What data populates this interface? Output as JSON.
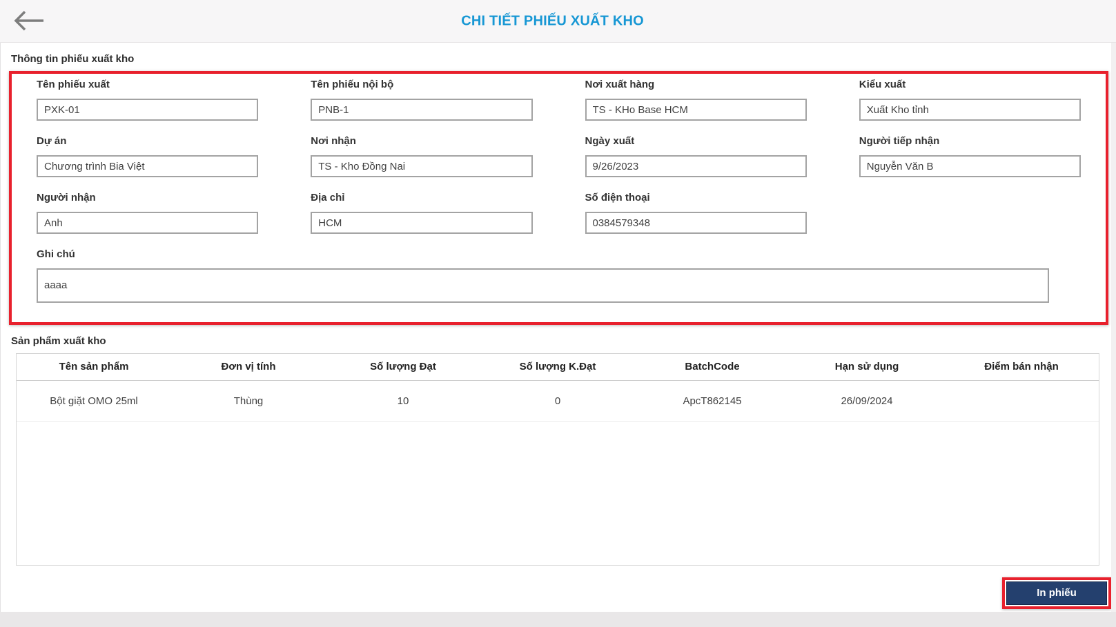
{
  "header": {
    "title": "CHI TIẾT PHIẾU XUẤT KHO"
  },
  "info_section": {
    "title": "Thông tin phiếu xuất kho",
    "fields": [
      {
        "label": "Tên phiếu xuất",
        "value": "PXK-01"
      },
      {
        "label": "Tên phiếu nội bộ",
        "value": "PNB-1"
      },
      {
        "label": "Nơi xuất hàng",
        "value": "TS - KHo Base HCM"
      },
      {
        "label": "Kiểu xuất",
        "value": "Xuất Kho tỉnh"
      },
      {
        "label": "Dự án",
        "value": "Chương trình Bia Việt"
      },
      {
        "label": "Nơi nhận",
        "value": "TS - Kho Đồng Nai"
      },
      {
        "label": "Ngày xuất",
        "value": "9/26/2023"
      },
      {
        "label": "Người tiếp nhận",
        "value": "Nguyễn Văn B"
      },
      {
        "label": "Người nhận",
        "value": "Anh"
      },
      {
        "label": "Địa chỉ",
        "value": "HCM"
      },
      {
        "label": "Số điện thoại",
        "value": "0384579348"
      },
      {
        "label": "Ghi chú",
        "value": "aaaa"
      }
    ]
  },
  "products_section": {
    "title": "Sản phẩm xuất kho",
    "table": {
      "columns": [
        "Tên sản phẩm",
        "Đơn vị tính",
        "Số lượng Đạt",
        "Số lượng K.Đạt",
        "BatchCode",
        "Hạn sử dụng",
        "Điểm bán nhận"
      ],
      "rows": [
        [
          "Bột giặt OMO 25ml",
          "Thùng",
          "10",
          "0",
          "ApcT862145",
          "26/09/2024",
          ""
        ]
      ]
    }
  },
  "footer": {
    "print_button": "In phiếu"
  },
  "colors": {
    "accent_blue": "#1797d4",
    "annotation_red": "#e8212d",
    "button_navy": "#24406e"
  }
}
